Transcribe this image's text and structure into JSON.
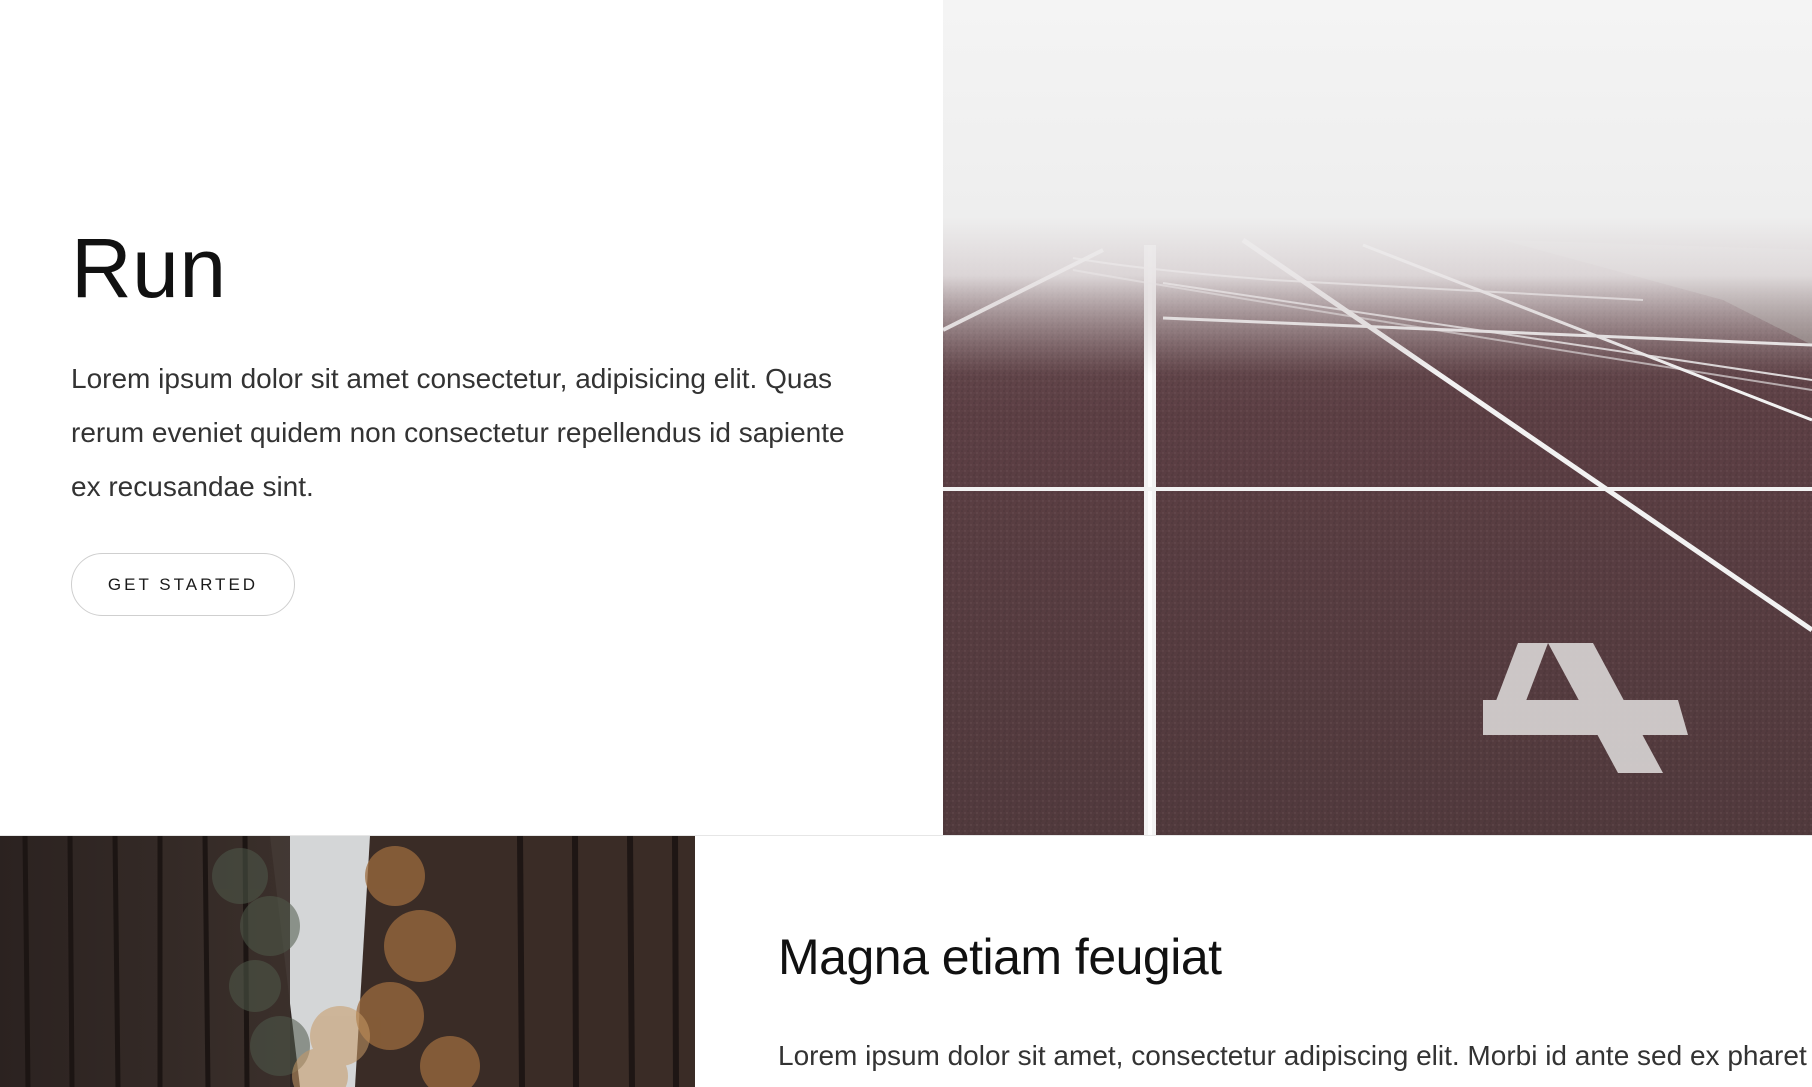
{
  "hero": {
    "title": "Run",
    "text": "Lorem ipsum dolor sit amet consectetur, adipisicing elit. Quas rerum eveniet quidem non consectetur repellendus id sapiente ex recusandae sint.",
    "cta_label": "GET STARTED",
    "lane_number": "4"
  },
  "feature": {
    "title": "Magna etiam feugiat",
    "text": "Lorem ipsum dolor sit amet, consectetur adipiscing elit. Morbi id ante sed ex pharetra"
  },
  "colors": {
    "background": "#ffffff",
    "track": "#5a3c40",
    "fog": "#efefef",
    "forest_dark": "#2e2522",
    "forest_light": "#b07a4a",
    "sky": "#d7d9da"
  }
}
